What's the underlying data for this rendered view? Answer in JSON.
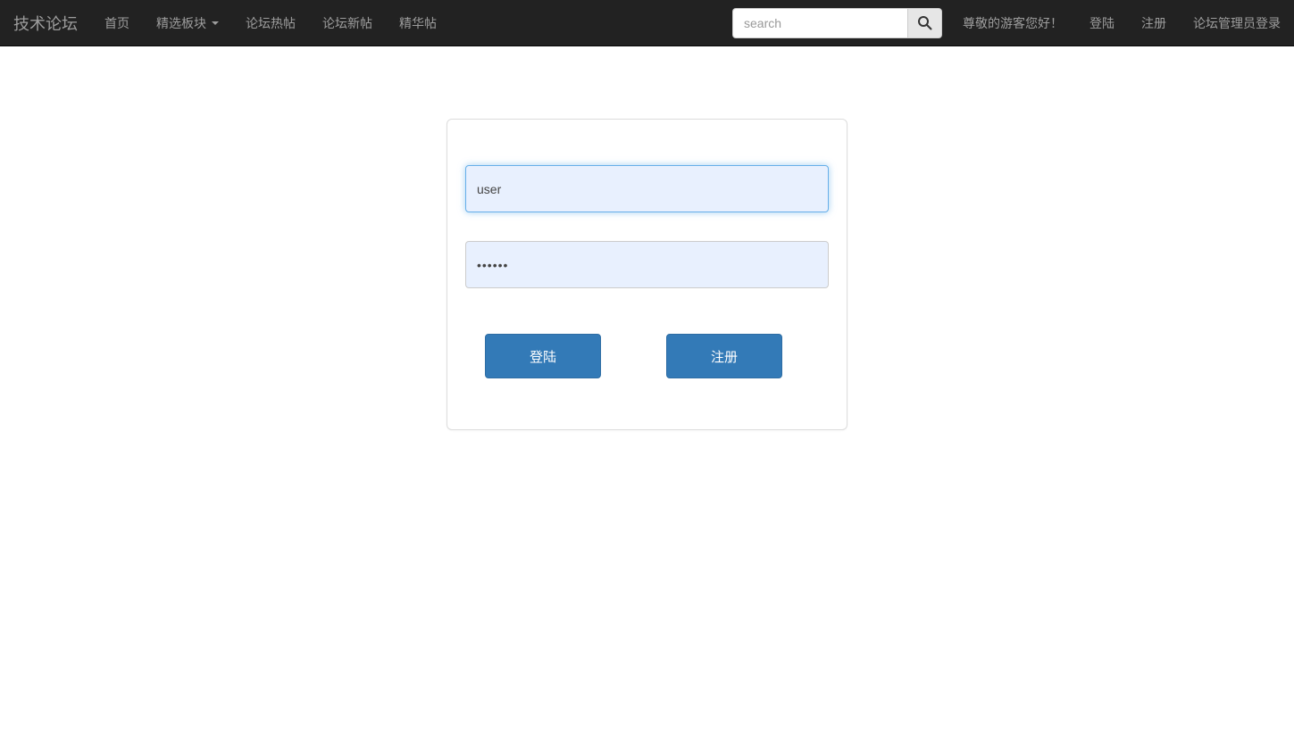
{
  "navbar": {
    "brand": "技术论坛",
    "items": [
      {
        "label": "首页"
      },
      {
        "label": "精选板块",
        "has_dropdown": true
      },
      {
        "label": "论坛热帖"
      },
      {
        "label": "论坛新帖"
      },
      {
        "label": "精华帖"
      }
    ],
    "search": {
      "placeholder": "search",
      "icon": "search-icon"
    },
    "right_items": [
      {
        "label": "尊敬的游客您好！"
      },
      {
        "label": "登陆"
      },
      {
        "label": "注册"
      },
      {
        "label": "论坛管理员登录"
      }
    ],
    "colors": {
      "background": "#222222",
      "text": "#9d9d9d",
      "border_bottom": "#080808"
    }
  },
  "login_panel": {
    "username_input": {
      "value": "user"
    },
    "password_input": {
      "value": "••••••"
    },
    "login_button_label": "登陆",
    "register_button_label": "注册",
    "colors": {
      "button_background": "#337ab7",
      "button_border": "#2e6da4",
      "input_background": "#e8f0fe",
      "focused_input_border": "#66afe9",
      "panel_border": "#dddddd"
    }
  }
}
